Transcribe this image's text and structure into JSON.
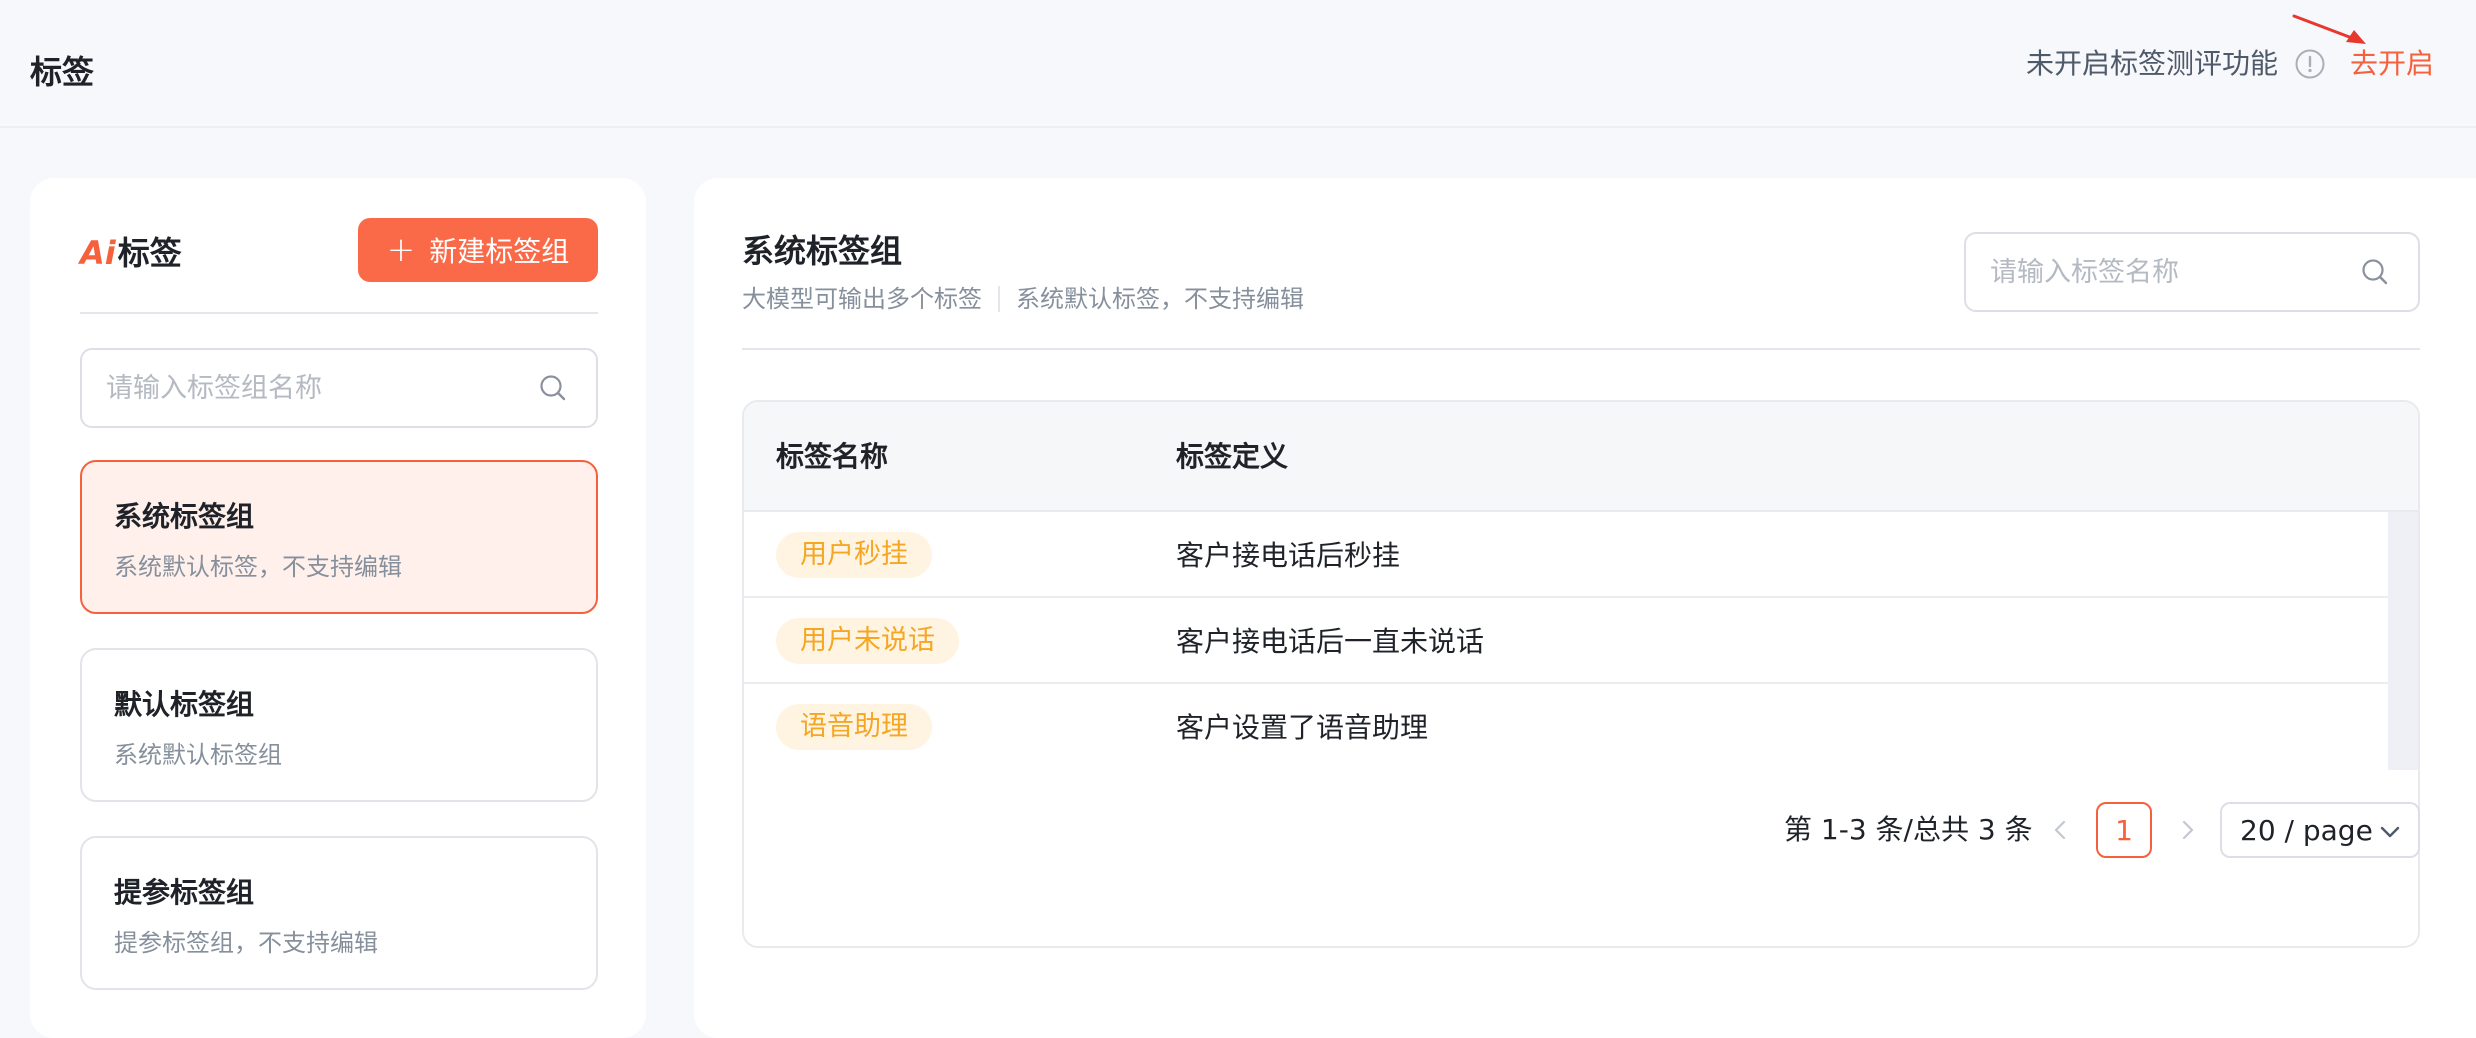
{
  "header": {
    "title": "标签",
    "eval_notice": "未开启标签测评功能",
    "open_link": "去开启"
  },
  "sidebar": {
    "logo_mark": "Ai",
    "logo_text": "标签",
    "new_group_label": "新建标签组",
    "search_placeholder": "请输入标签组名称",
    "groups": [
      {
        "name": "系统标签组",
        "desc": "系统默认标签，不支持编辑",
        "active": true
      },
      {
        "name": "默认标签组",
        "desc": "系统默认标签组",
        "active": false
      },
      {
        "name": "提参标签组",
        "desc": "提参标签组，不支持编辑",
        "active": false
      }
    ]
  },
  "main": {
    "title": "系统标签组",
    "subtitle_left": "大模型可输出多个标签",
    "subtitle_right": "系统默认标签，不支持编辑",
    "search_placeholder": "请输入标签名称",
    "table": {
      "columns": [
        "标签名称",
        "标签定义"
      ],
      "rows": [
        {
          "tag": "用户秒挂",
          "definition": "客户接电话后秒挂"
        },
        {
          "tag": "用户未说话",
          "definition": "客户接电话后一直未说话"
        },
        {
          "tag": "语音助理",
          "definition": "客户设置了语音助理"
        }
      ]
    },
    "pagination": {
      "total_text": "第 1-3 条/总共 3 条",
      "current_page": "1",
      "page_size": "20 / page"
    }
  },
  "colors": {
    "accent": "#f5613d",
    "tag_text": "#f5a623",
    "tag_bg": "#fff4e2"
  }
}
